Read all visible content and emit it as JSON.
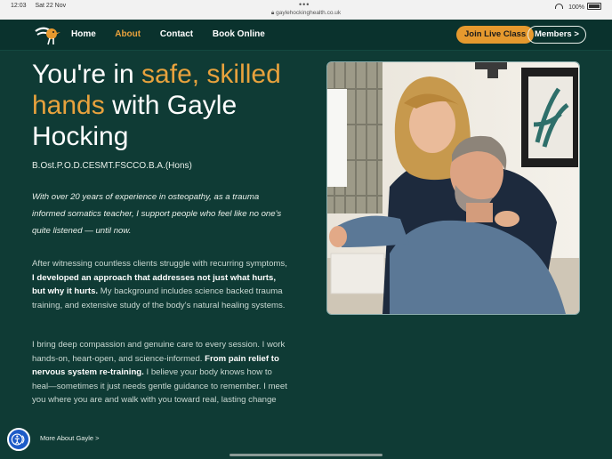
{
  "status_bar": {
    "time": "12:03",
    "date": "Sat 22 Nov",
    "url": "gaylehockinghealth.co.uk",
    "battery": "100%"
  },
  "nav": {
    "items": [
      {
        "label": "Home",
        "active": false
      },
      {
        "label": "About",
        "active": true
      },
      {
        "label": "Contact",
        "active": false
      },
      {
        "label": "Book Online",
        "active": false
      }
    ],
    "join_label": "Join Live Class",
    "members_label": "Members >"
  },
  "hero": {
    "headline_pre": "You're in ",
    "headline_accent1": "safe, skilled",
    "headline_accent2": "hands",
    "headline_post": " with Gayle Hocking",
    "credentials": "B.Ost.P.O.D.CESMT.FSCCO.B.A.(Hons)",
    "intro": "With over 20 years of experience in osteopathy, as a trauma informed somatics teacher, I support people who feel like no one's quite listened — until now.",
    "p1_a": "After witnessing countless clients struggle with recurring symptoms, ",
    "p1_b": "I developed an approach that addresses not just what hurts, but why it hurts.",
    "p1_c": " My background includes science backed trauma training, and extensive study of the body's natural healing systems.",
    "p2_a": "I bring deep compassion and genuine care to every session. I work hands-on, heart-open, and science-informed. ",
    "p2_b": "From pain relief to nervous system re-training.",
    "p2_c": " I believe your body knows how to heal—sometimes it just needs gentle guidance to remember. I meet you where you are and walk with you toward real, lasting change",
    "more_label": "More About Gayle  >"
  },
  "colors": {
    "background": "#0f3b35",
    "accent": "#e8a23d",
    "nav_bg": "#0a322d"
  },
  "icons": [
    "bird-logo-icon",
    "accessibility-icon",
    "wifi-icon",
    "battery-icon",
    "lock-icon"
  ]
}
